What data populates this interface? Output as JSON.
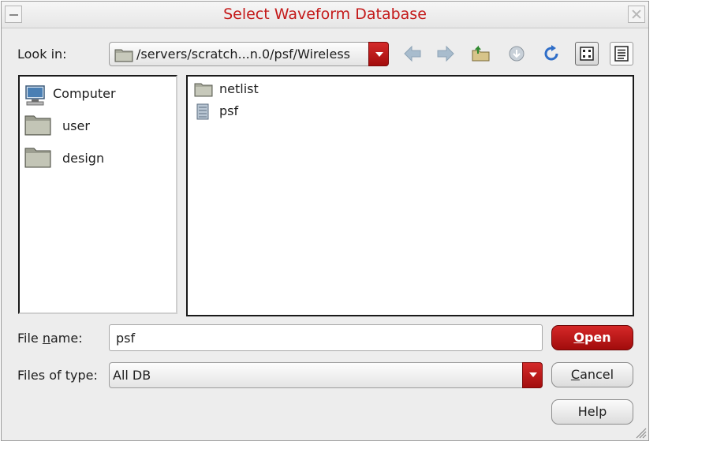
{
  "window": {
    "title": "Select Waveform Database"
  },
  "lookin": {
    "label": "Look in:",
    "path": "/servers/scratch...n.0/psf/Wireless"
  },
  "toolbar": {
    "icons": [
      "back-arrow-icon",
      "forward-arrow-icon",
      "up-folder-icon",
      "home-icon",
      "refresh-icon",
      "icon-view-icon",
      "list-view-icon"
    ],
    "view_mode": "icons"
  },
  "places": [
    {
      "label": "Computer",
      "icon": "computer-icon"
    },
    {
      "label": "user",
      "icon": "folder-icon"
    },
    {
      "label": "design",
      "icon": "folder-icon"
    }
  ],
  "files": [
    {
      "label": "netlist",
      "icon": "folder-icon"
    },
    {
      "label": "psf",
      "icon": "database-icon"
    }
  ],
  "filename": {
    "label_pre": "File ",
    "label_mnemonic": "n",
    "label_post": "ame:",
    "value": "psf"
  },
  "filetype": {
    "label": "Files of type:",
    "value": "All DB"
  },
  "buttons": {
    "open_mnemonic": "O",
    "open_rest": "pen",
    "cancel_mnemonic": "C",
    "cancel_rest": "ancel",
    "help": "Help"
  },
  "colors": {
    "title": "#c41a1a",
    "accent": "#b81414",
    "panel_bg": "#ededed"
  }
}
